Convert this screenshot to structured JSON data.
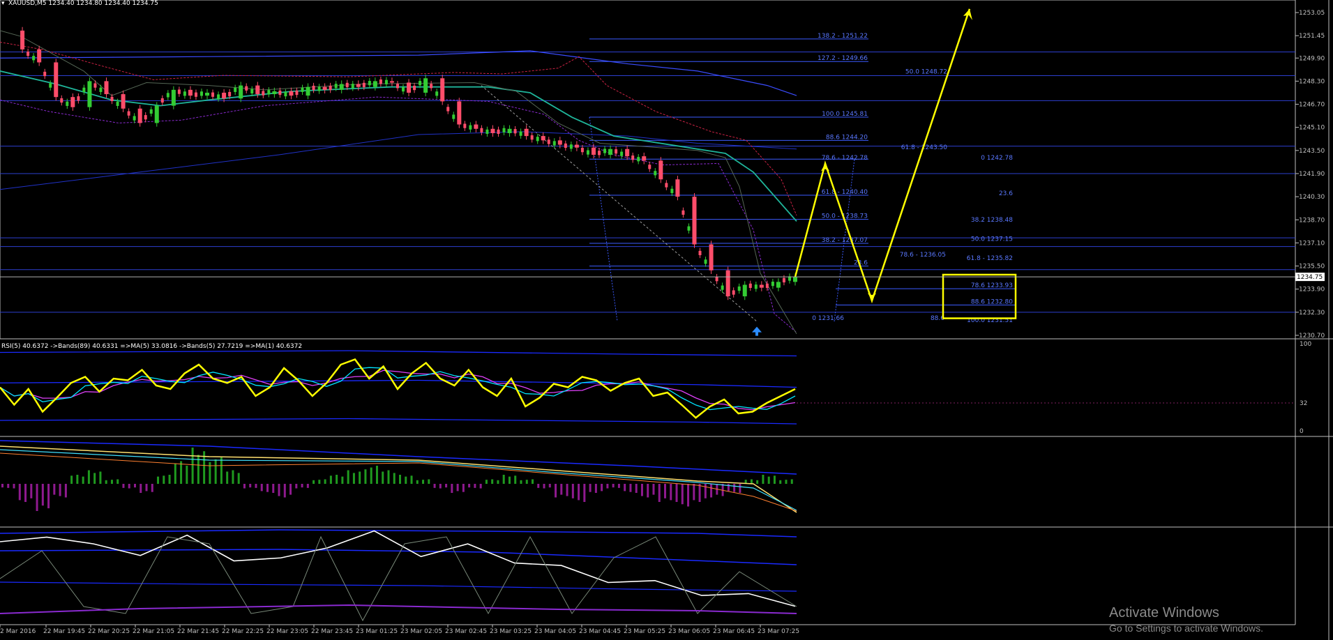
{
  "header": {
    "symbol_line": "XAUUSD,M5  1234.40 1234.80 1234.40 1234.75"
  },
  "colors": {
    "background": "#000000",
    "axis": "#c0c0c0",
    "bull_candle": "#33cc33",
    "bear_candle": "#ff4d6a",
    "ma_teal": "#1fb59a",
    "band_blue": "#2f3fff",
    "fib_line": "#3b5bff",
    "fib_text": "#5a78ff",
    "projection": "#ffff00",
    "rsi_line": "#ffff00",
    "rsi_ma": "#00e5ff",
    "rsi_ma2": "#e040fb",
    "hist_pos": "#1f9a1f",
    "hist_neg": "#8f1a8f"
  },
  "price_axis": {
    "labels": [
      "1253.05",
      "1251.45",
      "1249.90",
      "1248.30",
      "1246.70",
      "1245.10",
      "1243.50",
      "1241.90",
      "1240.30",
      "1238.70",
      "1237.10",
      "1235.50",
      "1233.90",
      "1232.30",
      "1230.70"
    ],
    "current_price": "1234.75"
  },
  "time_axis": {
    "labels": [
      "2 Mar 2016",
      "22 Mar 19:45",
      "22 Mar 20:25",
      "22 Mar 21:05",
      "22 Mar 21:45",
      "22 Mar 22:25",
      "22 Mar 23:05",
      "22 Mar 23:45",
      "23 Mar 01:25",
      "23 Mar 02:05",
      "23 Mar 02:45",
      "23 Mar 03:25",
      "23 Mar 04:05",
      "23 Mar 04:45",
      "23 Mar 05:25",
      "23 Mar 06:05",
      "23 Mar 06:45",
      "23 Mar 07:25"
    ]
  },
  "fib_labels": [
    {
      "id": "f1",
      "text": "138.2 - 1251.22"
    },
    {
      "id": "f2",
      "text": "127.2 - 1249.66"
    },
    {
      "id": "f3",
      "text": "50.0 1248.72"
    },
    {
      "id": "f4",
      "text": "100.0 1245.81"
    },
    {
      "id": "f5",
      "text": "88.6 1244.20"
    },
    {
      "id": "f6",
      "text": "61.8 - 1243.50"
    },
    {
      "id": "f7",
      "text": "78.6 - 1242.78"
    },
    {
      "id": "f8",
      "text": "0 1242.78"
    },
    {
      "id": "f9",
      "text": "61.8 - 1240.40"
    },
    {
      "id": "f10",
      "text": "23.6"
    },
    {
      "id": "f11",
      "text": "50.0 - 1238.73"
    },
    {
      "id": "f12",
      "text": "38.2 1238.48"
    },
    {
      "id": "f13",
      "text": "38.2 - 1237.07"
    },
    {
      "id": "f14",
      "text": "50.0 1237.15"
    },
    {
      "id": "f15",
      "text": "78.6 - 1236.05"
    },
    {
      "id": "f16",
      "text": "61.8 - 1235.82"
    },
    {
      "id": "f17",
      "text": "23.6"
    },
    {
      "id": "f18",
      "text": "78.6 1233.93"
    },
    {
      "id": "f19",
      "text": "88.6 1232.80"
    },
    {
      "id": "f20",
      "text": "0 1231.66"
    },
    {
      "id": "f21",
      "text": "88.6"
    },
    {
      "id": "f22",
      "text": "100.0 1231.51"
    }
  ],
  "rsi_panel": {
    "label": "RSI(5) 40.6372  ->Bands(89) 40.6331  =>MA(5) 33.0816  ->Bands(5) 27.7219  =>MA(1) 40.6372",
    "scale": [
      "100",
      "32",
      "0"
    ]
  },
  "watermark": {
    "line1": "Activate Windows",
    "line2": "Go to Settings to activate Windows."
  },
  "chart_data": [
    {
      "type": "candlestick",
      "title": "XAUUSD,M5",
      "ohlc_last": {
        "open": 1234.4,
        "high": 1234.8,
        "low": 1234.4,
        "close": 1234.75
      },
      "ylim": [
        1230.7,
        1253.05
      ],
      "x_ticks": [
        "2 Mar 2016",
        "22 Mar 19:45",
        "22 Mar 20:25",
        "22 Mar 21:05",
        "22 Mar 21:45",
        "22 Mar 22:25",
        "22 Mar 23:05",
        "22 Mar 23:45",
        "23 Mar 01:25",
        "23 Mar 02:05",
        "23 Mar 02:45",
        "23 Mar 03:25",
        "23 Mar 04:05",
        "23 Mar 04:45",
        "23 Mar 05:25",
        "23 Mar 06:05",
        "23 Mar 06:45",
        "23 Mar 07:25"
      ],
      "close_path": [
        1251.8,
        1250.5,
        1249.6,
        1247.2,
        1246.5,
        1248.3,
        1247.4,
        1246.4,
        1245.4,
        1246.6,
        1247.7,
        1247.3,
        1247.5,
        1247.1,
        1248.0,
        1247.4,
        1247.6,
        1247.3,
        1247.9,
        1247.7,
        1248.1,
        1247.9,
        1248.3,
        1248.2,
        1247.5,
        1248.5,
        1246.9,
        1245.3,
        1245.0,
        1244.7,
        1245.0,
        1244.5,
        1244.2,
        1243.9,
        1243.7,
        1243.2,
        1243.6,
        1243.1,
        1242.8,
        1241.5,
        1240.3,
        1237.0,
        1235.2,
        1233.4,
        1234.2,
        1234.0,
        1234.4,
        1234.75
      ],
      "horizontal_levels": [
        1250.32,
        1248.68,
        1246.95,
        1243.8,
        1241.9,
        1237.45,
        1236.85,
        1235.25,
        1232.3
      ],
      "projection_path": [
        1234.75,
        1242.6,
        1233.1,
        1253.3
      ],
      "projection_box": {
        "low": 1231.88,
        "high": 1234.9
      }
    },
    {
      "type": "line",
      "title": "RSI(5)",
      "ylim": [
        0,
        100
      ],
      "levels": [
        32
      ],
      "rsi_last": 40.6372,
      "bands89": 40.6331,
      "ma5": 33.0816,
      "bands5": 27.7219,
      "ma1": 40.6372,
      "series": [
        {
          "name": "RSI(5)",
          "values": [
            50,
            30,
            48,
            22,
            38,
            55,
            62,
            45,
            60,
            58,
            70,
            52,
            48,
            66,
            76,
            60,
            55,
            62,
            40,
            50,
            72,
            58,
            40,
            55,
            76,
            82,
            60,
            74,
            48,
            66,
            78,
            60,
            52,
            70,
            50,
            40,
            60,
            28,
            38,
            54,
            50,
            62,
            58,
            46,
            55,
            60,
            40,
            44,
            30,
            15,
            28,
            36,
            20,
            22,
            32,
            40,
            48
          ]
        }
      ]
    },
    {
      "type": "bar",
      "title": "MACD histogram",
      "series": [
        {
          "values": [
            -1,
            -4,
            -6,
            -3,
            2,
            3,
            1,
            -1,
            -2,
            2,
            5,
            8,
            6,
            3,
            -1,
            -2,
            -3,
            -1,
            1,
            2,
            3,
            4,
            3,
            2,
            1,
            -1,
            -2,
            -1,
            1,
            2,
            1,
            -1,
            -3,
            -4,
            -2,
            -1,
            -2,
            -3,
            -4,
            -5,
            -4,
            -3,
            -2,
            1,
            2,
            1
          ]
        }
      ]
    },
    {
      "type": "line",
      "title": "oscillator",
      "series": [
        {
          "values": [
            60,
            72,
            58,
            55,
            66,
            50,
            45,
            62,
            70,
            54,
            58,
            48,
            38,
            30,
            24,
            18,
            12,
            8
          ]
        }
      ]
    }
  ]
}
